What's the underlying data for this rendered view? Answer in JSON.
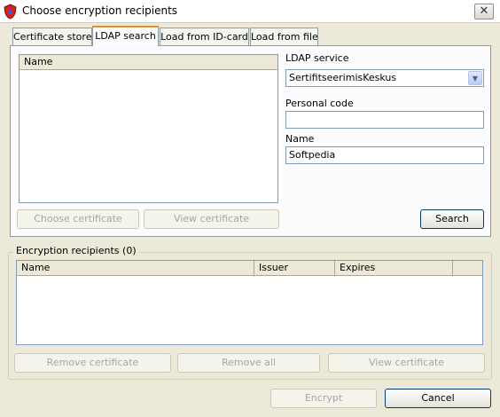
{
  "window": {
    "title": "Choose encryption recipients",
    "close_glyph": "✕"
  },
  "tabs": [
    {
      "label": "Certificate store",
      "active": false
    },
    {
      "label": "LDAP search",
      "active": true
    },
    {
      "label": "Load from ID-card",
      "active": false
    },
    {
      "label": "Load from file",
      "active": false
    }
  ],
  "ldap": {
    "list_header": "Name",
    "service_label": "LDAP service",
    "service_value": "SertifitseerimisKeskus",
    "personal_code_label": "Personal code",
    "personal_code_value": "",
    "name_label": "Name",
    "name_value": "Softpedia",
    "choose_button": "Choose certificate",
    "view_button": "View certificate",
    "search_button": "Search"
  },
  "recipients": {
    "title": "Encryption recipients (0)",
    "columns": [
      "Name",
      "Issuer",
      "Expires"
    ],
    "remove_button": "Remove certificate",
    "remove_all_button": "Remove all",
    "view_button": "View certificate"
  },
  "footer": {
    "encrypt_button": "Encrypt",
    "cancel_button": "Cancel"
  },
  "colors": {
    "tab_accent": "#e68b2c",
    "field_border": "#7f9db9",
    "dialog_bg": "#ece9d8"
  },
  "icons": {
    "app": "shield-icon",
    "close": "close-icon",
    "combo": "chevron-down-icon"
  }
}
